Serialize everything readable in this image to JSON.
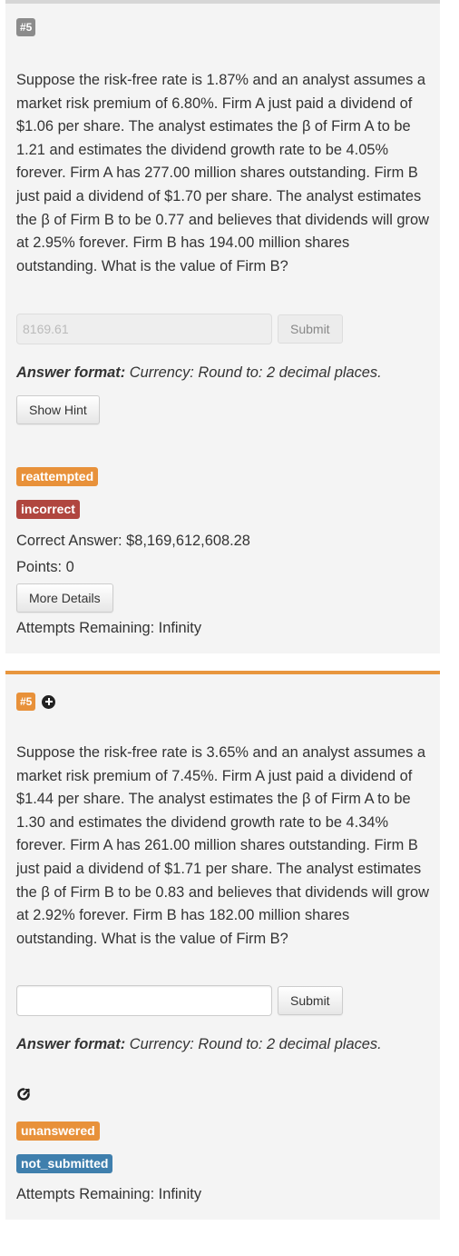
{
  "questions": [
    {
      "number": "#5",
      "text": "Suppose the risk-free rate is 1.87% and an analyst assumes a market risk premium of 6.80%. Firm A just paid a dividend of $1.06 per share. The analyst estimates the β of Firm A to be 1.21 and estimates the dividend growth rate to be 4.05% forever. Firm A has 277.00 million shares outstanding. Firm B just paid a dividend of $1.70 per share. The analyst estimates the β of Firm B to be 0.77 and believes that dividends will grow at 2.95% forever. Firm B has 194.00 million shares outstanding. What is the value of Firm B?",
      "answer_value": "8169.61",
      "submit_label": "Submit",
      "answer_format_label": "Answer format:",
      "answer_format_value": "Currency: Round to: 2 decimal places.",
      "hint_label": "Show Hint",
      "status_badges": [
        "reattempted",
        "incorrect"
      ],
      "correct_answer": "Correct Answer: $8,169,612,608.28",
      "points": "Points: 0",
      "details_label": "More Details",
      "attempts": "Attempts Remaining: Infinity"
    },
    {
      "number": "#5",
      "text": "Suppose the risk-free rate is 3.65% and an analyst assumes a market risk premium of 7.45%. Firm A just paid a dividend of $1.44 per share. The analyst estimates the β of Firm A to be 1.30 and estimates the dividend growth rate to be 4.34% forever. Firm A has 261.00 million shares outstanding. Firm B just paid a dividend of $1.71 per share. The analyst estimates the β of Firm B to be 0.83 and believes that dividends will grow at 2.92% forever. Firm B has 182.00 million shares outstanding. What is the value of Firm B?",
      "answer_value": "",
      "submit_label": "Submit",
      "answer_format_label": "Answer format:",
      "answer_format_value": "Currency: Round to: 2 decimal places.",
      "status_badges": [
        "unanswered",
        "not_submitted"
      ],
      "attempts": "Attempts Remaining: Infinity"
    }
  ],
  "colors": {
    "badge_gray": "#8c8c8c",
    "badge_orange": "#e8913a",
    "badge_red": "#b0463f",
    "badge_blue": "#3f7fad",
    "active_border": "#e8963e"
  }
}
